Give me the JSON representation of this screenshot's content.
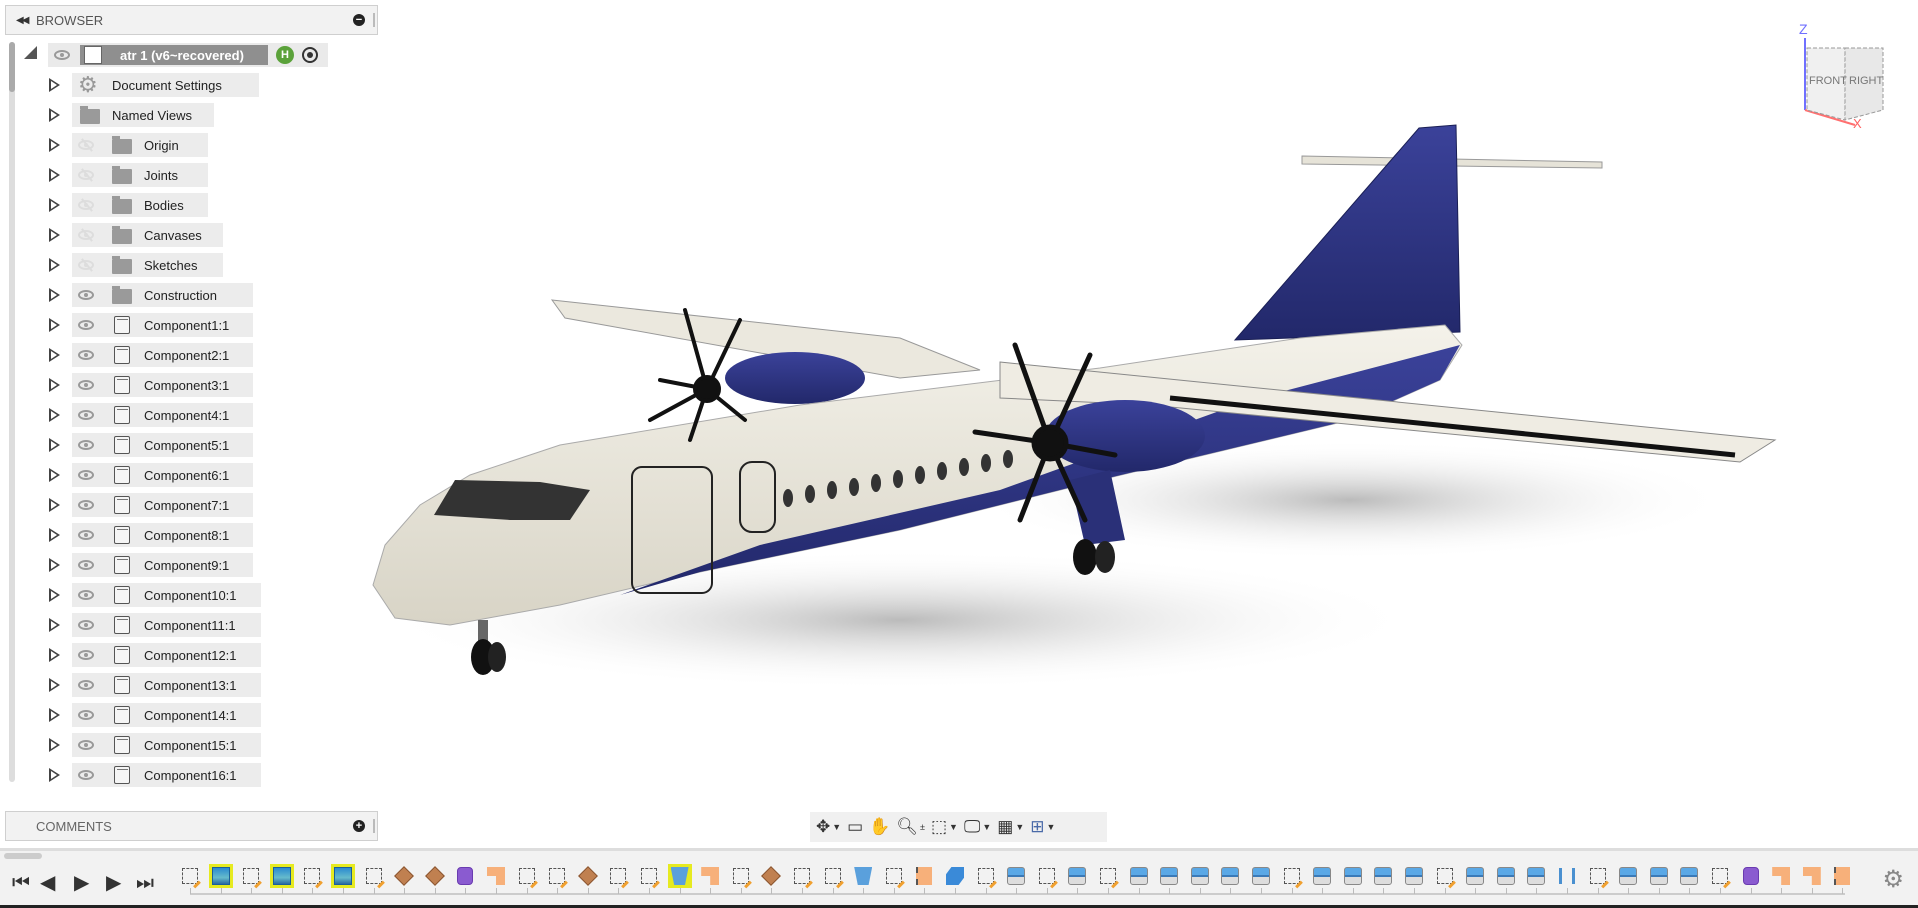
{
  "browser": {
    "title": "BROWSER",
    "root": {
      "label": "atr 1 (v6~recovered)"
    },
    "items": [
      {
        "label": "Document Settings",
        "icon": "gear",
        "eye": "none"
      },
      {
        "label": "Named Views",
        "icon": "folder",
        "eye": "none"
      },
      {
        "label": "Origin",
        "icon": "folder",
        "eye": "hidden"
      },
      {
        "label": "Joints",
        "icon": "folder",
        "eye": "hidden"
      },
      {
        "label": "Bodies",
        "icon": "folder",
        "eye": "hidden"
      },
      {
        "label": "Canvases",
        "icon": "folder",
        "eye": "hidden"
      },
      {
        "label": "Sketches",
        "icon": "folder",
        "eye": "hidden"
      },
      {
        "label": "Construction",
        "icon": "folder",
        "eye": "visible"
      },
      {
        "label": "Component1:1",
        "icon": "component",
        "eye": "visible"
      },
      {
        "label": "Component2:1",
        "icon": "component",
        "eye": "visible"
      },
      {
        "label": "Component3:1",
        "icon": "component",
        "eye": "visible"
      },
      {
        "label": "Component4:1",
        "icon": "component",
        "eye": "visible"
      },
      {
        "label": "Component5:1",
        "icon": "component",
        "eye": "visible"
      },
      {
        "label": "Component6:1",
        "icon": "component",
        "eye": "visible"
      },
      {
        "label": "Component7:1",
        "icon": "component",
        "eye": "visible"
      },
      {
        "label": "Component8:1",
        "icon": "component",
        "eye": "visible"
      },
      {
        "label": "Component9:1",
        "icon": "component",
        "eye": "visible"
      },
      {
        "label": "Component10:1",
        "icon": "component",
        "eye": "visible"
      },
      {
        "label": "Component11:1",
        "icon": "component",
        "eye": "visible"
      },
      {
        "label": "Component12:1",
        "icon": "component",
        "eye": "visible"
      },
      {
        "label": "Component13:1",
        "icon": "component",
        "eye": "visible"
      },
      {
        "label": "Component14:1",
        "icon": "component",
        "eye": "visible"
      },
      {
        "label": "Component15:1",
        "icon": "component",
        "eye": "visible"
      },
      {
        "label": "Component16:1",
        "icon": "component",
        "eye": "visible"
      }
    ]
  },
  "comments": {
    "title": "COMMENTS"
  },
  "viewcube": {
    "front": "FRONT",
    "right": "RIGHT",
    "z": "Z",
    "x": "X"
  },
  "navbar": [
    "orbit-icon",
    "look-at-icon",
    "pan-icon",
    "zoom-icon",
    "fit-icon",
    "display-settings-icon",
    "grid-icon",
    "viewports-icon"
  ],
  "timeline": {
    "legend": {
      "S": "sketch",
      "C": "canvas",
      "D": "decal",
      "F": "form",
      "O": "fillet",
      "T": "split",
      "E": "extrude",
      "L": "loft",
      "B": "combine",
      "P": "pattern"
    },
    "features": "S C S C S C S D D F O S S D S S L O S D S S L S T B S E S E S E E E E E S E E E E S E E E P S E E E S F O O T",
    "selected": [
      1,
      3,
      5,
      16
    ]
  },
  "colors": {
    "fuselage": "#ece9df",
    "livery": "#2e3580",
    "selected": "#e6ea20"
  }
}
